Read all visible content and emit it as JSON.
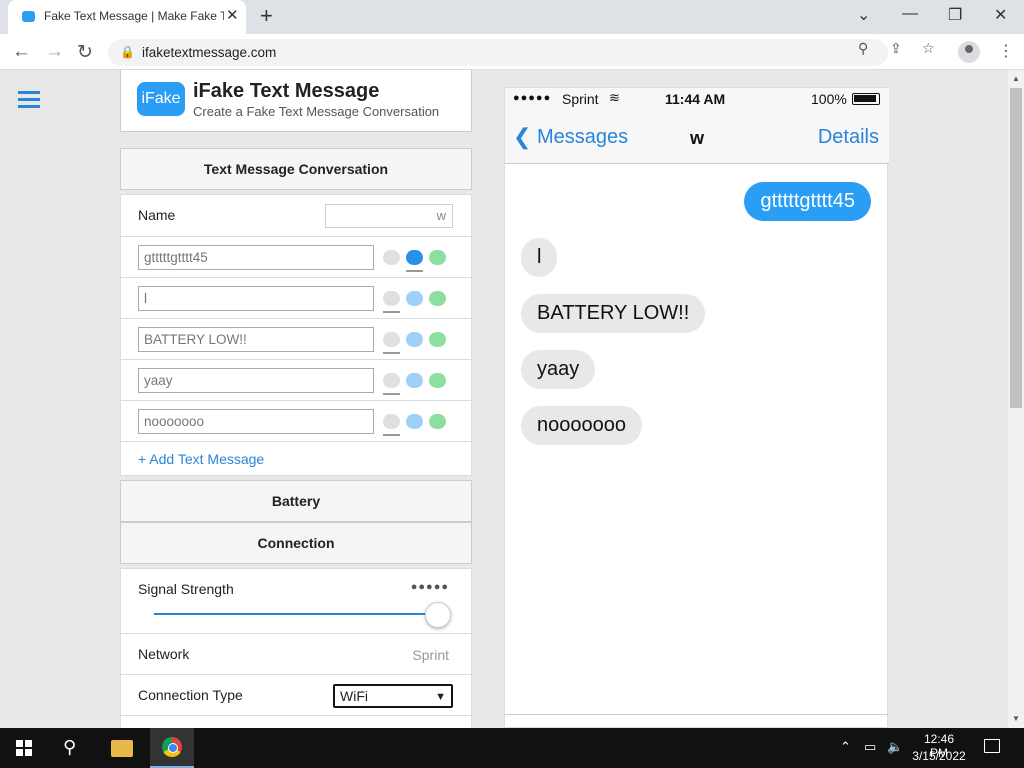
{
  "browser": {
    "tab_title": "Fake Text Message | Make Fake Te",
    "tab_close": "✕",
    "new_tab": "+",
    "url": "ifaketextmessage.com",
    "window_minimize": "—",
    "window_restore": "❐",
    "window_close": "✕",
    "tab_list": "⌄"
  },
  "brand": {
    "logo_text": "iFake",
    "title": "iFake Text Message",
    "subtitle": "Create a Fake Text Message Conversation"
  },
  "editor": {
    "conversation_header": "Text Message Conversation",
    "name_label": "Name",
    "name_value": "w",
    "messages": [
      "gtttttgtttt45",
      "l",
      "BATTERY LOW!!",
      "yaay",
      "nooooooo"
    ],
    "add_message": "+ Add Text Message",
    "battery_header": "Battery",
    "connection_header": "Connection",
    "signal_label": "Signal Strength",
    "signal_dots": "●●●●●",
    "network_label": "Network",
    "network_value": "Sprint",
    "connection_type_label": "Connection Type",
    "connection_type_value": "WiFi",
    "accent_color": "#2a85d8"
  },
  "phone": {
    "signal": "●●●●●",
    "carrier": "Sprint",
    "time": "11:44 AM",
    "battery": "100%",
    "back_label": "Messages",
    "contact": "w",
    "details": "Details",
    "sent_color": "#2a9df4",
    "received_color": "#e8e8e8",
    "messages": [
      {
        "text": "gtttttgtttt45",
        "direction": "sent"
      },
      {
        "text": "l",
        "direction": "received"
      },
      {
        "text": "BATTERY LOW!!",
        "direction": "received"
      },
      {
        "text": "yaay",
        "direction": "received"
      },
      {
        "text": "nooooooo",
        "direction": "received"
      }
    ]
  },
  "taskbar": {
    "time": "12:46 PM",
    "date": "3/15/2022"
  }
}
